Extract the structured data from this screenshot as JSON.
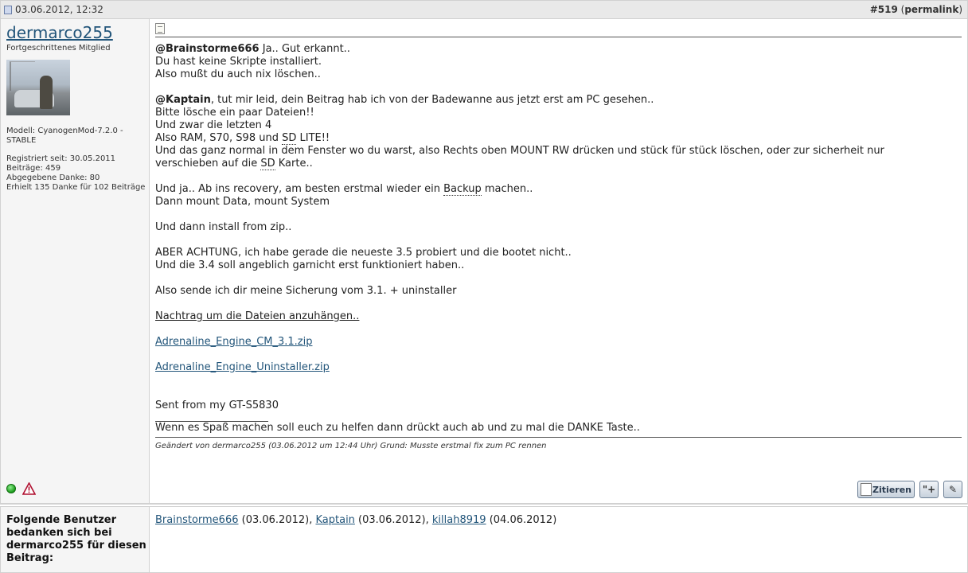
{
  "post": {
    "datetime": "03.06.2012, 12:32",
    "number": "#519",
    "permalink_label": "permalink"
  },
  "user": {
    "name": "dermarco255",
    "title": "Fortgeschrittenes Mitglied",
    "model": "Modell: CyanogenMod-7.2.0 - STABLE",
    "registered": "Registriert seit: 30.05.2011",
    "posts": "Beiträge: 459",
    "thanks_given": "Abgegebene Danke: 80",
    "thanks_received": "Erhielt 135 Danke für 102 Beiträge"
  },
  "message": {
    "mention1": "@Brainstorme666",
    "l1_rest": " Ja.. Gut erkannt..",
    "l2": "Du hast keine Skripte installiert.",
    "l3": "Also mußt du auch nix löschen..",
    "mention2": "@Kaptain",
    "l4_rest": ", tut mir leid, dein Beitrag hab ich von der Badewanne aus jetzt erst am PC gesehen..",
    "l5": "Bitte lösche ein paar Dateien!!",
    "l6": "Und zwar die letzten 4",
    "l7a": "Also RAM, S70, S98 und ",
    "l7b": "SD",
    "l7c": " LITE!!",
    "l8": "Und das ganz normal in dem Fenster wo du warst, also Rechts oben MOUNT RW drücken und stück für stück löschen, oder zur sicherheit nur",
    "l9a": "verschieben auf die ",
    "l9b": "SD",
    "l9c": " Karte..",
    "l10a": "Und ja.. Ab ins recovery, am besten erstmal wieder ein ",
    "l10b": "Backup",
    "l10c": " machen..",
    "l11": "Dann mount Data, mount System",
    "l12": "Und dann install from zip..",
    "l13": "ABER ACHTUNG, ich habe gerade die neueste 3.5 probiert und die bootet nicht..",
    "l14": "Und die 3.4 soll angeblich garnicht erst funktioniert haben..",
    "l15": "Also sende ich dir meine Sicherung vom 3.1. + uninstaller",
    "l16": "Nachtrag um die Dateien anzuhängen..",
    "attachment1": "Adrenaline_Engine_CM_3.1.zip",
    "attachment2": "Adrenaline_Engine_Uninstaller.zip",
    "sent_from": "Sent from my GT-S5830",
    "signature": "Wenn es Spaß machen soll euch zu helfen dann drückt auch ab und zu mal die DANKE Taste.."
  },
  "edited_note": "Geändert von dermarco255 (03.06.2012 um 12:44 Uhr) Grund: Musste erstmal fix zum PC rennen",
  "buttons": {
    "quote_label": "Zitieren",
    "multiquote_label": "\"+",
    "quickreply_label": "✎"
  },
  "thanks": {
    "label": "Folgende Benutzer bedanken sich bei dermarco255 für diesen Beitrag:",
    "users": [
      {
        "name": "Brainstorme666",
        "date": " (03.06.2012), "
      },
      {
        "name": "Kaptain",
        "date": " (03.06.2012), "
      },
      {
        "name": "killah8919",
        "date": " (04.06.2012)"
      }
    ]
  }
}
